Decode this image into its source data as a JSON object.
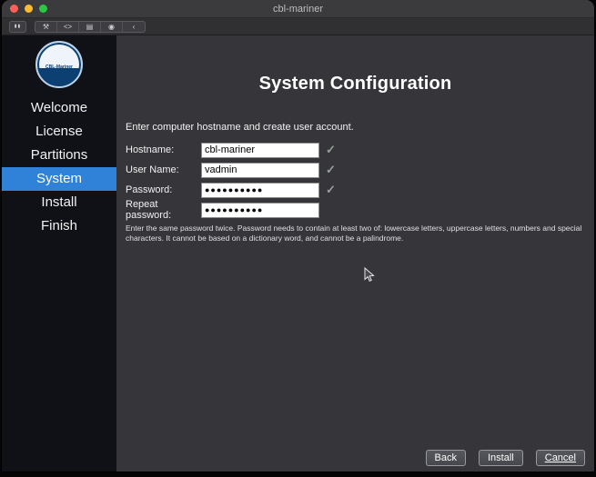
{
  "window": {
    "title": "cbl-mariner"
  },
  "toolbar": {
    "pause_glyph": "▮▮",
    "icons": [
      {
        "name": "tools",
        "glyph": "⚒"
      },
      {
        "name": "console",
        "glyph": "<>"
      },
      {
        "name": "printer",
        "glyph": "▤"
      },
      {
        "name": "camera",
        "glyph": "◉"
      },
      {
        "name": "back",
        "glyph": "‹"
      }
    ]
  },
  "sidebar": {
    "logo_text": "CBL-Mariner",
    "items": [
      {
        "label": "Welcome",
        "active": false
      },
      {
        "label": "License",
        "active": false
      },
      {
        "label": "Partitions",
        "active": false
      },
      {
        "label": "System",
        "active": true
      },
      {
        "label": "Install",
        "active": false
      },
      {
        "label": "Finish",
        "active": false
      }
    ]
  },
  "main": {
    "title": "System Configuration",
    "subtitle": "Enter computer hostname and create user account.",
    "fields": [
      {
        "label": "Hostname:",
        "value": "cbl-mariner",
        "check": "✓"
      },
      {
        "label": "User Name:",
        "value": "vadmin",
        "check": "✓"
      },
      {
        "label": "Password:",
        "value": "●●●●●●●●●●",
        "check": "✓"
      },
      {
        "label": "Repeat password:",
        "value": "●●●●●●●●●●",
        "check": ""
      }
    ],
    "help_text": "Enter the same password twice. Password needs to contain at least two of: lowercase letters, uppercase letters, numbers and special characters. It cannot be based on a dictionary word, and cannot be a palindrome.",
    "buttons": [
      {
        "label": "Back"
      },
      {
        "label": "Install"
      },
      {
        "label": "Cancel"
      }
    ]
  },
  "colors": {
    "accent_blue": "#2f82d8",
    "valid_check_gray": "#97a097"
  }
}
